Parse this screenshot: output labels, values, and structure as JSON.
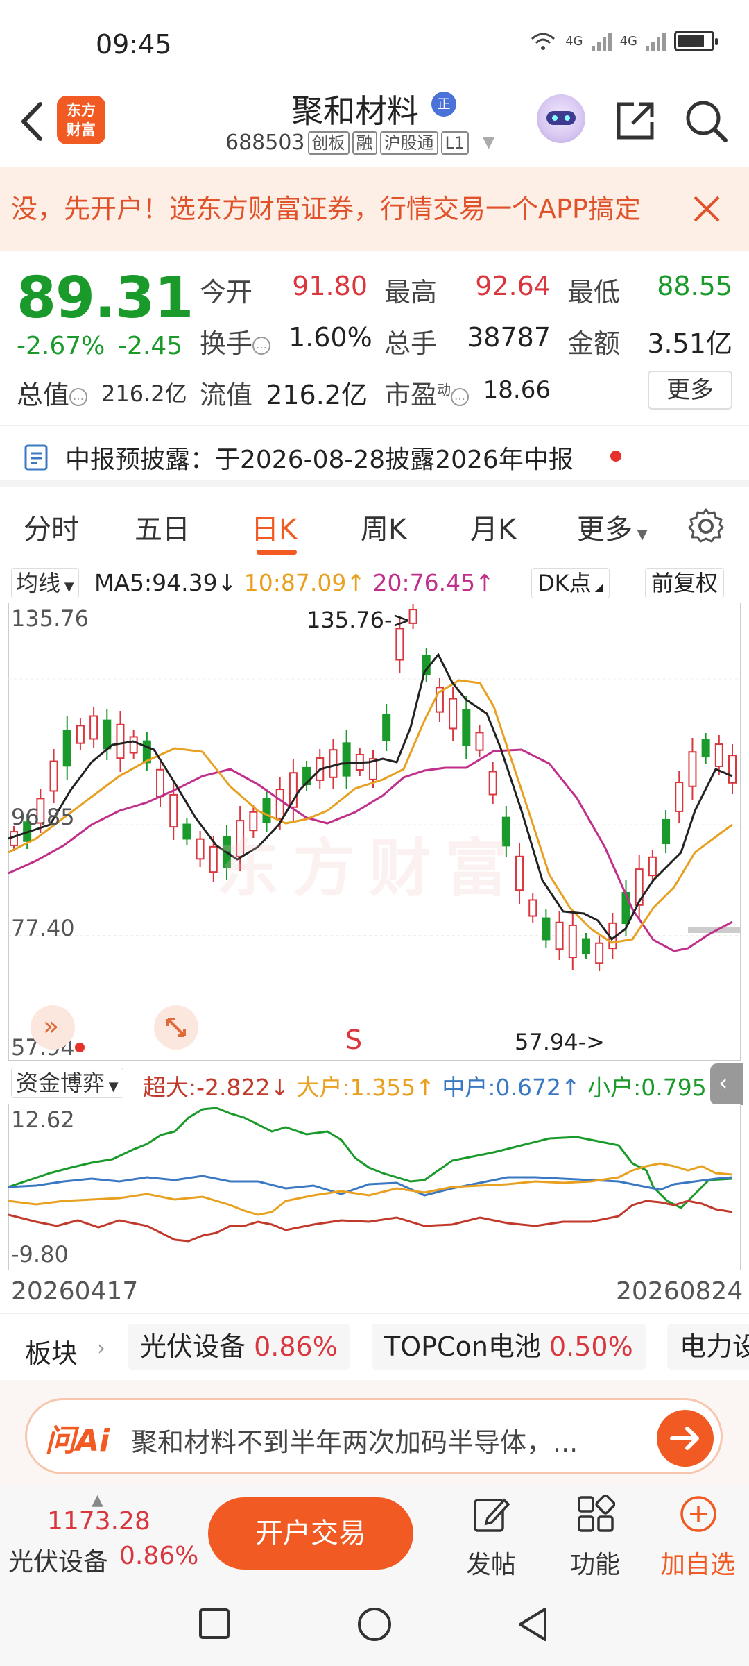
{
  "status": {
    "time": "09:45",
    "network_1": "4G",
    "network_2": "4G"
  },
  "header": {
    "logo_line1": "东方",
    "logo_line2": "财富",
    "stock_name": "聚和材料",
    "name_badge": "正",
    "code": "688503",
    "tags": [
      "创板",
      "融",
      "沪股通",
      "L1"
    ]
  },
  "banner": {
    "text": "没，先开户！选东方财富证券，行情交易一个APP搞定"
  },
  "quote": {
    "price": "89.31",
    "change_pct": "-2.67%",
    "change": "-2.45",
    "market_cap_label": "总值",
    "market_cap": "216.2亿",
    "fields": [
      {
        "label": "今开",
        "value": "91.80",
        "color": "#d9363e"
      },
      {
        "label": "最高",
        "value": "92.64",
        "color": "#d9363e"
      },
      {
        "label": "最低",
        "value": "88.55",
        "color": "#1a9a2a"
      },
      {
        "label": "换手",
        "value": "1.60%",
        "color": "#222222"
      },
      {
        "label": "总手",
        "value": "38787",
        "color": "#222222"
      },
      {
        "label": "金额",
        "value": "3.51亿",
        "color": "#222222"
      },
      {
        "label": "流值",
        "value": "216.2亿",
        "color": "#222222"
      },
      {
        "label": "市盈",
        "value": "18.66",
        "color": "#222222"
      }
    ],
    "pe_superscript": "动",
    "more_label": "更多"
  },
  "disclosure": {
    "text": "中报预披露：于2026-08-28披露2026年中报"
  },
  "tabs": [
    {
      "label": "分时",
      "active": false
    },
    {
      "label": "五日",
      "active": false
    },
    {
      "label": "日K",
      "active": true
    },
    {
      "label": "周K",
      "active": false
    },
    {
      "label": "月K",
      "active": false
    },
    {
      "label": "更多",
      "active": false
    }
  ],
  "ma": {
    "selector": "均线",
    "ma5": "MA5:94.39",
    "ma10": "10:87.09",
    "ma20": "20:76.45",
    "dk_label": "DK点",
    "adj_label": "前复权",
    "colors": {
      "ma5": "#222222",
      "ma10": "#e8a020",
      "ma20": "#c0308a"
    }
  },
  "kline": {
    "y_labels": [
      "135.76",
      "96.85",
      "77.40",
      "57.94"
    ],
    "high_annot": "135.76->",
    "low_annot": "57.94->",
    "signal": "S",
    "watermark": "东方财富"
  },
  "flow": {
    "selector": "资金博弈",
    "items": [
      {
        "label": "超大:-2.822",
        "arrow": "↓",
        "color": "#c0392b"
      },
      {
        "label": "大户:1.355",
        "arrow": "↑",
        "color": "#e8a020"
      },
      {
        "label": "中户:0.672",
        "arrow": "↑",
        "color": "#3a78c2"
      },
      {
        "label": "小户:0.795",
        "arrow": "↑",
        "color": "#1a9a2a"
      }
    ],
    "y_top": "12.62",
    "y_bottom": "-9.80",
    "date_start": "20260417",
    "date_end": "20260824"
  },
  "sectors": {
    "label": "板块",
    "chips": [
      {
        "name": "光伏设备",
        "pct": "0.86%"
      },
      {
        "name": "TOPCon电池",
        "pct": "0.50%"
      },
      {
        "name": "电力设",
        "pct": ""
      }
    ]
  },
  "ai": {
    "logo": "问Ai",
    "text": "聚和材料不到半年两次加码半导体，..."
  },
  "bottom": {
    "index_value": "1173.28",
    "sector_name": "光伏设备",
    "sector_pct": "0.86%",
    "open_account": "开户交易",
    "post": "发帖",
    "functions": "功能",
    "add_watch": "加自选"
  }
}
